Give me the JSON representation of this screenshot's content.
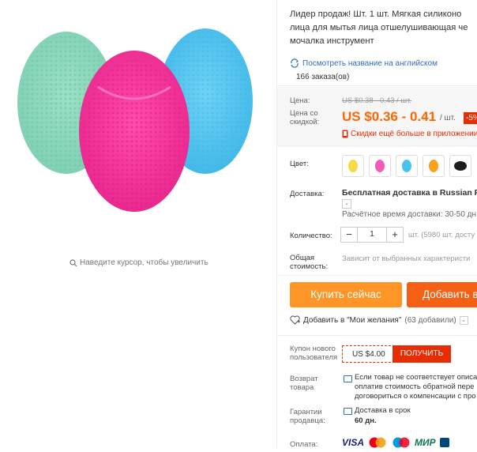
{
  "gallery": {
    "zoom_hint": "Наведите курсор, чтобы увеличить",
    "colors": {
      "mint": "#8fd8bd",
      "blue": "#4fc3ee",
      "pink": "#f23a9e"
    }
  },
  "product": {
    "title_lines": [
      "Лидер продаж! Шт. 1 шт. Мягкая силиконо",
      "лица для мытья лица отшелушивающая че",
      "мочалка инструмент"
    ],
    "translate_link": "Посмотреть название на английском",
    "orders": "166 заказа(ов)"
  },
  "price": {
    "label_price": "Цена:",
    "old_price": "US $0.38 - 0.43 / шт.",
    "label_discount": [
      "Цена со",
      "скидкой:"
    ],
    "current_price": "US $0.36 - 0.41",
    "per_unit": "/ шт.",
    "discount_badge": "-5%",
    "more_discounts": "Скидки ещё больше в приложении"
  },
  "options": {
    "color_label": "Цвет:",
    "swatches": [
      {
        "name": "yellow",
        "color": "#f9d94a"
      },
      {
        "name": "pink",
        "color": "#f25bb6"
      },
      {
        "name": "blue",
        "color": "#47c3ef"
      },
      {
        "name": "orange",
        "color": "#f7a21c"
      },
      {
        "name": "black",
        "color": "#1d1d1d"
      }
    ],
    "shipping_label": "Доставка:",
    "shipping_main": "Бесплатная доставка в Russian Fede",
    "shipping_time": "Расчётное время доставки: 30-50 дн.",
    "quantity_label": "Количество:",
    "quantity_value": "1",
    "quantity_units": "шт. (5980 шт. досту",
    "total_label": [
      "Общая",
      "стоимость:"
    ],
    "total_value": "Зависит от выбранных характеристи"
  },
  "actions": {
    "buy_now": "Купить сейчас",
    "add_to_cart": "Добавить в",
    "wishlist": "Добавить в \"Мои желания\"",
    "wishlist_count": "(63 добавили)"
  },
  "coupon": {
    "label": [
      "Купон нового",
      "пользователя"
    ],
    "amount": "US $4.00",
    "get": "ПОЛУЧИТЬ"
  },
  "return": {
    "label": [
      "Возврат",
      "товара"
    ],
    "lines": [
      "Если товар не соответствует описа",
      "оплатив стоимость обратной пере",
      "договориться о компенсации с про"
    ]
  },
  "guarantee": {
    "label": [
      "Гарантии",
      "продавца:"
    ],
    "delivery": "Доставка в срок",
    "days": "60 дн."
  },
  "payment": {
    "label": "Оплата:",
    "methods": [
      "VISA",
      "Mastercard",
      "Maestro",
      "МИР",
      "PayPal"
    ]
  }
}
